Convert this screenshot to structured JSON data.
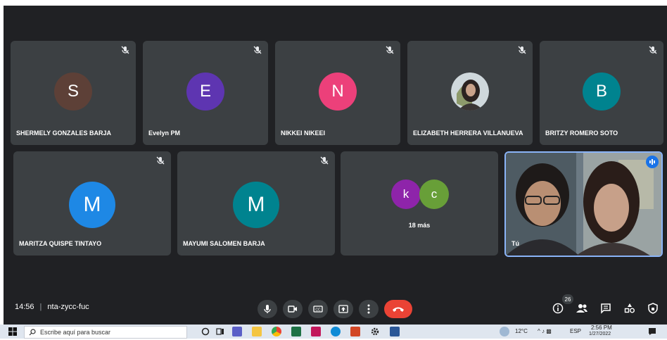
{
  "colors": {
    "meet_bg": "#202124",
    "tile_bg": "#3c4043",
    "end_call": "#ea4335",
    "speaking": "#1a73e8"
  },
  "participants": [
    {
      "name": "SHERMELY GONZALES BARJA",
      "initial": "S",
      "color": "#5d4037",
      "muted": true
    },
    {
      "name": "Evelyn PM",
      "initial": "E",
      "color": "#5e35b1",
      "muted": true
    },
    {
      "name": "NIKKEI NIKEEI",
      "initial": "N",
      "color": "#ec407a",
      "muted": true
    },
    {
      "name": "ELIZABETH HERRERA VILLANUEVA",
      "initial": "",
      "photo": true,
      "muted": true
    },
    {
      "name": "BRITZY ROMERO SOTO",
      "initial": "B",
      "color": "#00838f",
      "muted": true
    },
    {
      "name": "MARITZA QUISPE TINTAYO",
      "initial": "M",
      "color": "#1e88e5",
      "muted": true
    },
    {
      "name": "MAYUMI SALOMEN BARJA",
      "initial": "M",
      "color": "#00838f",
      "muted": true
    }
  ],
  "more": {
    "avatars": [
      {
        "initial": "k",
        "color": "#8e24aa"
      },
      {
        "initial": "c",
        "color": "#689f38"
      }
    ],
    "label": "18 más"
  },
  "self": {
    "name": "Tú"
  },
  "meeting": {
    "time": "14:56",
    "separator": "|",
    "code": "nta-zycc-fuc"
  },
  "controls": [
    "mic-icon",
    "camera-icon",
    "captions-icon",
    "present-icon",
    "more-options-icon",
    "end-call-icon"
  ],
  "right_controls": [
    "info-icon",
    "people-icon",
    "chat-icon",
    "activities-icon",
    "host-controls-icon"
  ],
  "people_count": "26",
  "taskbar": {
    "search_placeholder": "Escribe aquí para buscar",
    "temp": "12°C",
    "lang": "ESP",
    "time": "2:56 PM",
    "date": "1/27/2022"
  }
}
